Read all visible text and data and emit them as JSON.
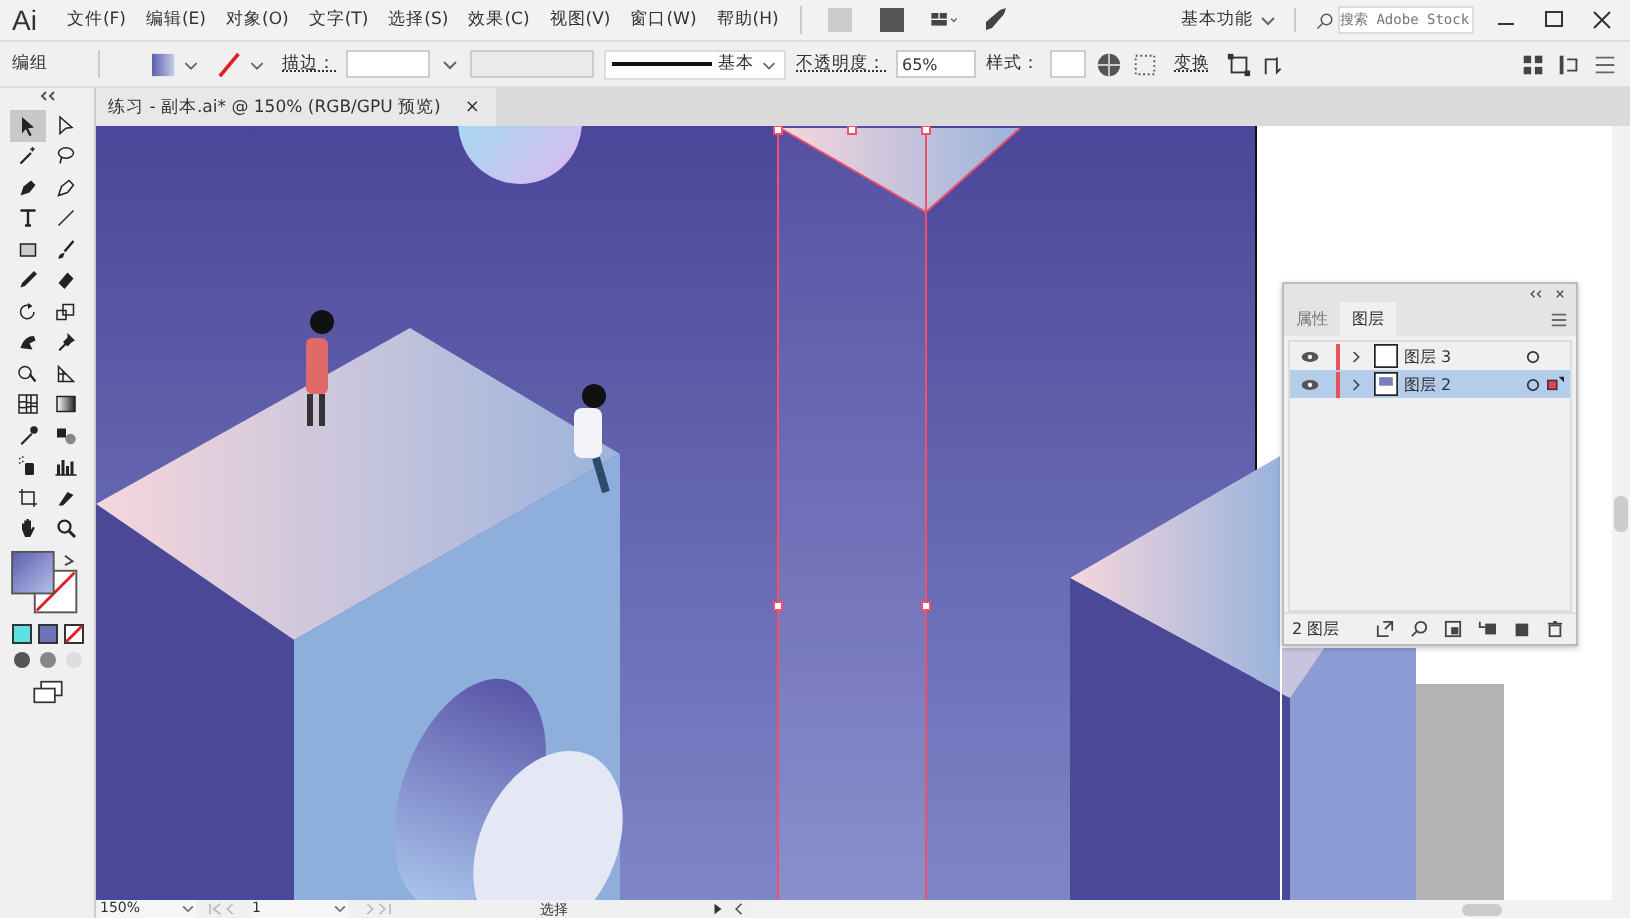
{
  "app": {
    "logo": "Ai"
  },
  "menu": [
    "文件(F)",
    "编辑(E)",
    "对象(O)",
    "文字(T)",
    "选择(S)",
    "效果(C)",
    "视图(V)",
    "窗口(W)",
    "帮助(H)"
  ],
  "top_right": {
    "workspace": "基本功能",
    "search": {
      "placeholder": "搜索 Adobe Stock"
    }
  },
  "control_bar": {
    "selection": "编组",
    "stroke_label": "描边：",
    "profile": "基本",
    "opacity_label": "不透明度：",
    "opacity": "65%",
    "style_label": "样式：",
    "transform": "变换"
  },
  "document_tab": {
    "title": "练习 - 副本.ai* @ 150% (RGB/GPU 预览)",
    "close": "×"
  },
  "tools": [
    {
      "kind": "select",
      "selected": true
    },
    {
      "kind": "direct",
      "selected": false
    },
    {
      "kind": "wand",
      "selected": false
    },
    {
      "kind": "lasso",
      "selected": false
    },
    {
      "kind": "pen",
      "selected": false
    },
    {
      "kind": "curvature",
      "selected": false
    },
    {
      "kind": "type",
      "selected": false
    },
    {
      "kind": "line",
      "selected": false
    },
    {
      "kind": "rect",
      "selected": false
    },
    {
      "kind": "brush",
      "selected": false
    },
    {
      "kind": "pencil",
      "selected": false
    },
    {
      "kind": "eraser",
      "selected": false
    },
    {
      "kind": "rotate",
      "selected": false
    },
    {
      "kind": "scale",
      "selected": false
    },
    {
      "kind": "warp",
      "selected": false
    },
    {
      "kind": "pin",
      "selected": false
    },
    {
      "kind": "shapebuilder",
      "selected": false
    },
    {
      "kind": "perspective",
      "selected": false
    },
    {
      "kind": "mesh",
      "selected": false
    },
    {
      "kind": "gradient",
      "selected": false
    },
    {
      "kind": "eyedropper",
      "selected": false
    },
    {
      "kind": "blend",
      "selected": false
    },
    {
      "kind": "sprayer",
      "selected": false
    },
    {
      "kind": "graph",
      "selected": false
    },
    {
      "kind": "artboard",
      "selected": false
    },
    {
      "kind": "slice",
      "selected": false
    },
    {
      "kind": "hand",
      "selected": false
    },
    {
      "kind": "zoom",
      "selected": false
    }
  ],
  "layers_panel": {
    "tabs": [
      {
        "label": "属性",
        "selected": false
      },
      {
        "label": "图层",
        "selected": true
      }
    ],
    "layers": [
      {
        "name": "图层 3",
        "visible": true,
        "selected": false
      },
      {
        "name": "图层 2",
        "visible": true,
        "selected": true
      }
    ],
    "footer": "2 图层"
  },
  "status_bar": {
    "zoom": "150%",
    "artboard": "1",
    "tool": "选择"
  }
}
